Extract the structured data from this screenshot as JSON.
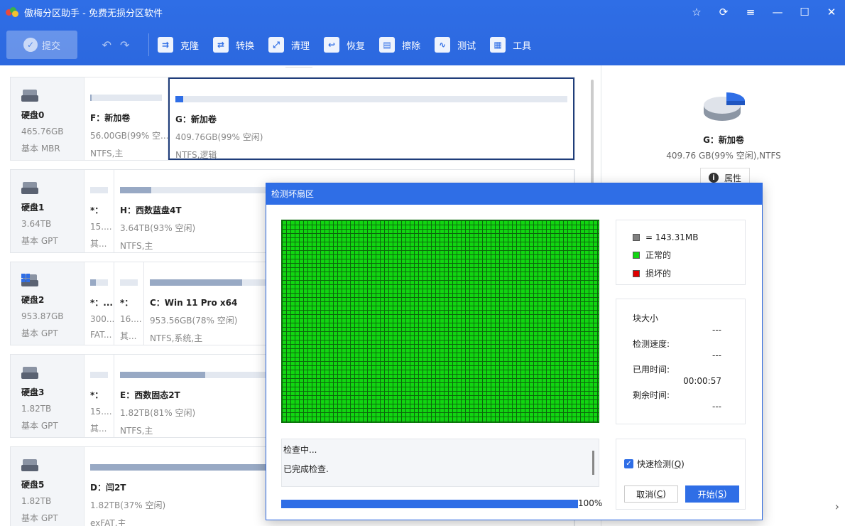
{
  "app": {
    "title": "傲梅分区助手 - 免费无损分区软件"
  },
  "toolbar": {
    "commit_label": "提交",
    "tools": [
      {
        "label": "克隆",
        "icon": "clone-icon"
      },
      {
        "label": "转换",
        "icon": "convert-icon"
      },
      {
        "label": "清理",
        "icon": "clean-icon"
      },
      {
        "label": "恢复",
        "icon": "recover-icon"
      },
      {
        "label": "擦除",
        "icon": "wipe-icon"
      },
      {
        "label": "测试",
        "icon": "test-icon"
      },
      {
        "label": "工具",
        "icon": "tools-icon"
      }
    ]
  },
  "disks": [
    {
      "name": "硬盘0",
      "size": "465.76GB",
      "type": "基本 MBR",
      "parts": [
        {
          "name": "F：新加卷",
          "size": "56.00GB(99% 空...",
          "fs": "NTFS,主",
          "used": 0.01
        },
        {
          "name": "G：新加卷",
          "size": "409.76GB(99% 空闲)",
          "fs": "NTFS,逻辑",
          "used": 0.01
        }
      ]
    },
    {
      "name": "硬盘1",
      "size": "3.64TB",
      "type": "基本 GPT",
      "parts": [
        {
          "name": "*：",
          "size": "15....",
          "fs": "其...",
          "used": 0
        },
        {
          "name": "H：西数蓝盘4T",
          "size": "3.64TB(93% 空闲)",
          "fs": "NTFS,主",
          "used": 0.07
        }
      ]
    },
    {
      "name": "硬盘2",
      "size": "953.87GB",
      "type": "基本 GPT",
      "parts": [
        {
          "name": "*：...",
          "size": "300...",
          "fs": "FAT...",
          "used": 0.3
        },
        {
          "name": "*：",
          "size": "16....",
          "fs": "其...",
          "used": 0
        },
        {
          "name": "C：Win 11 Pro x64",
          "size": "953.56GB(78% 空闲)",
          "fs": "NTFS,系统,主",
          "used": 0.22
        }
      ]
    },
    {
      "name": "硬盘3",
      "size": "1.82TB",
      "type": "基本 GPT",
      "parts": [
        {
          "name": "*：",
          "size": "15....",
          "fs": "其...",
          "used": 0
        },
        {
          "name": "E：西数固态2T",
          "size": "1.82TB(81% 空闲)",
          "fs": "NTFS,主",
          "used": 0.19
        }
      ]
    },
    {
      "name": "硬盘5",
      "size": "1.82TB",
      "type": "基本 GPT",
      "parts": [
        {
          "name": "D：闫2T",
          "size": "1.82TB(37% 空闲)",
          "fs": "exFAT,主",
          "used": 0.63
        }
      ]
    }
  ],
  "info": {
    "name": "G：新加卷",
    "sub": "409.76 GB(99% 空闲),NTFS",
    "props_label": "属性",
    "used_fraction": 0.01
  },
  "dialog": {
    "title": "检测坏扇区",
    "legend": {
      "block": "= 143.31MB",
      "normal": "正常的",
      "bad": "损坏的"
    },
    "stats": [
      {
        "label": "块大小",
        "value": "---"
      },
      {
        "label": "检测速度:",
        "value": "---"
      },
      {
        "label": "已用时间:",
        "value": "00:00:57"
      },
      {
        "label": "剩余时间:",
        "value": "---"
      }
    ],
    "log": [
      "检查中...",
      "已完成检查."
    ],
    "progress": 100,
    "progress_label": "100%",
    "quick_label": "快速检测",
    "quick_key": "Q",
    "quick_checked": true,
    "cancel_label": "取消",
    "cancel_key": "C",
    "start_label": "开始",
    "start_key": "S",
    "colors": {
      "normal": "#11d611",
      "bad": "#e00000",
      "block": "#808080"
    }
  }
}
